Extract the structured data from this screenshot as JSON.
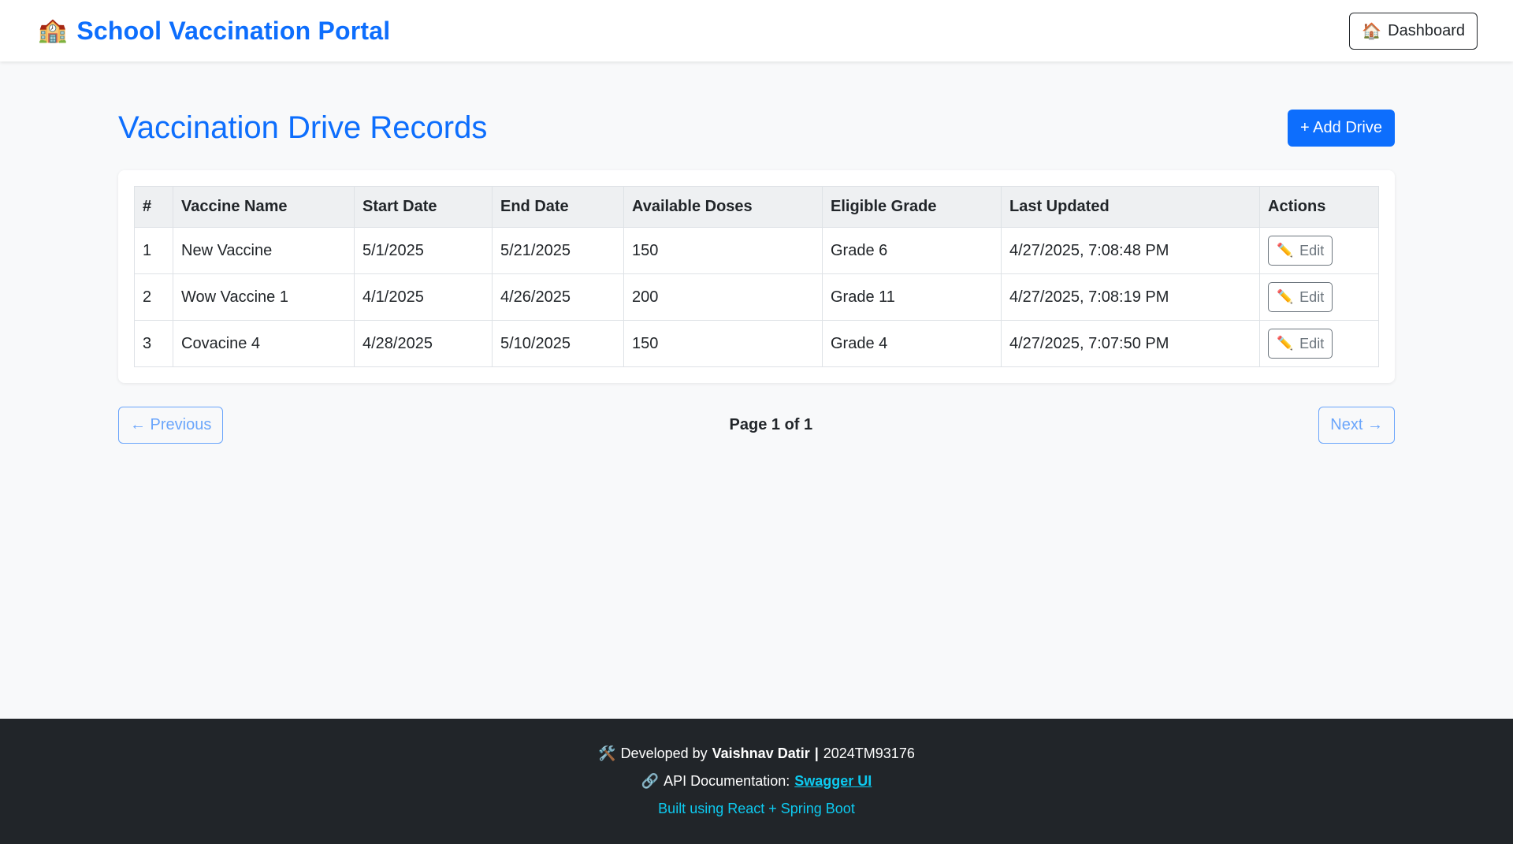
{
  "navbar": {
    "brand_icon": "🏫",
    "brand_text": "School Vaccination Portal",
    "dashboard_icon": "🏠",
    "dashboard_label": "Dashboard"
  },
  "page": {
    "title": "Vaccination Drive Records",
    "add_button": "+ Add Drive"
  },
  "table": {
    "headers": [
      "#",
      "Vaccine Name",
      "Start Date",
      "End Date",
      "Available Doses",
      "Eligible Grade",
      "Last Updated",
      "Actions"
    ],
    "rows": [
      {
        "num": "1",
        "name": "New Vaccine",
        "start": "5/1/2025",
        "end": "5/21/2025",
        "doses": "150",
        "grade": "Grade 6",
        "updated": "4/27/2025, 7:08:48 PM",
        "action": "Edit"
      },
      {
        "num": "2",
        "name": "Wow Vaccine 1",
        "start": "4/1/2025",
        "end": "4/26/2025",
        "doses": "200",
        "grade": "Grade 11",
        "updated": "4/27/2025, 7:08:19 PM",
        "action": "Edit"
      },
      {
        "num": "3",
        "name": "Covacine 4",
        "start": "4/28/2025",
        "end": "5/10/2025",
        "doses": "150",
        "grade": "Grade 4",
        "updated": "4/27/2025, 7:07:50 PM",
        "action": "Edit"
      }
    ],
    "edit_icon": "✏️"
  },
  "pagination": {
    "previous": "← Previous",
    "info": "Page 1 of 1",
    "next": "Next →"
  },
  "footer": {
    "dev_icon": "🛠️",
    "dev_prefix": "Developed by",
    "dev_name": "Vaishnav Datir",
    "dev_sep": "|",
    "dev_id": "2024TM93176",
    "api_icon": "🔗",
    "api_prefix": "API Documentation:",
    "api_link": "Swagger UI",
    "built": "Built using React + Spring Boot"
  },
  "colors": {
    "primary": "#0d6efd",
    "footer_bg": "#212529",
    "footer_link": "#0dcaf0",
    "page_bg": "#f8f9fa"
  }
}
